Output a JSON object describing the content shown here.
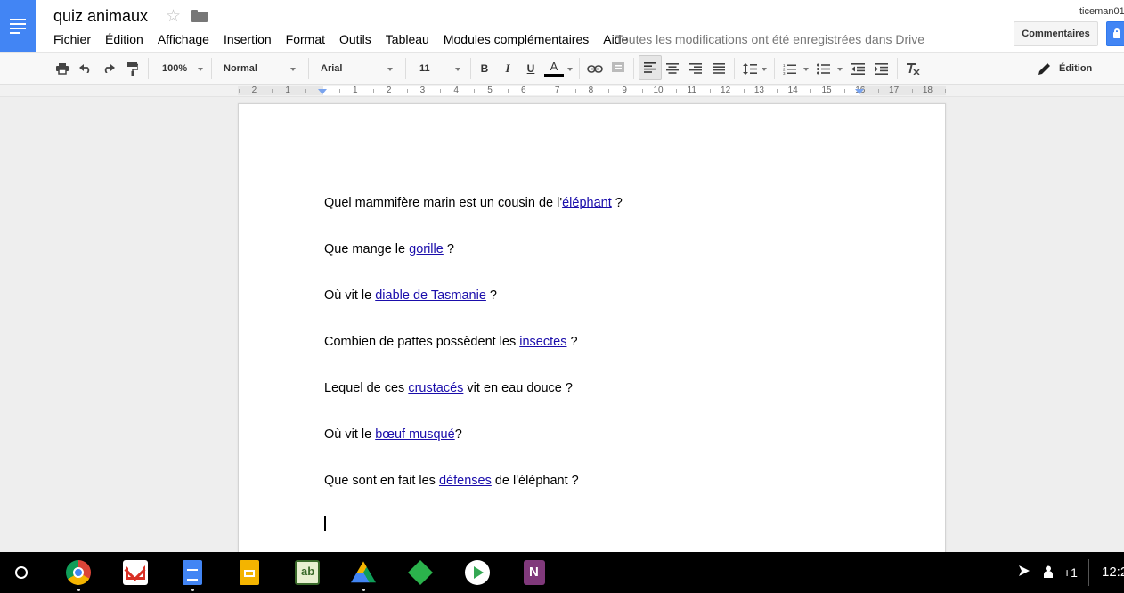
{
  "header": {
    "title": "quiz animaux",
    "save_status": "Toutes les modifications ont été enregistrées dans Drive",
    "user": "ticeman01",
    "comments_label": "Commentaires"
  },
  "menubar": {
    "items": [
      "Fichier",
      "Édition",
      "Affichage",
      "Insertion",
      "Format",
      "Outils",
      "Tableau",
      "Modules complémentaires",
      "Aide"
    ]
  },
  "toolbar": {
    "zoom": "100%",
    "style": "Normal",
    "font": "Arial",
    "font_size": "11",
    "bold": "B",
    "italic": "I",
    "underline": "U",
    "text_color_glyph": "A",
    "text_color": "#000000",
    "mode_label": "Édition"
  },
  "ruler": {
    "labels": [
      "2",
      "1",
      "1",
      "2",
      "3",
      "4",
      "5",
      "6",
      "7",
      "8",
      "9",
      "10",
      "11",
      "12",
      "13",
      "14",
      "15",
      "16",
      "17",
      "18"
    ]
  },
  "document": {
    "paragraphs": [
      {
        "before": "Quel mammifère marin est un cousin de l'",
        "link": "éléphant",
        "after": " ?"
      },
      {
        "before": "Que mange le ",
        "link": "gorille",
        "after": " ?"
      },
      {
        "before": "Où vit le ",
        "link": "diable de Tasmanie",
        "after": " ?"
      },
      {
        "before": "Combien de pattes possèdent les ",
        "link": "insectes",
        "after": " ?"
      },
      {
        "before": "Lequel de ces ",
        "link": "crustacés",
        "after": " vit en eau douce ?"
      },
      {
        "before": "Où vit le ",
        "link": "bœuf musqué",
        "after": "?"
      },
      {
        "before": "Que sont en fait les ",
        "link": "défenses",
        "after": " de l'éléphant ?"
      }
    ]
  },
  "shelf": {
    "apps": [
      "chrome-icon",
      "gmail-icon",
      "google-docs-icon",
      "google-slides-icon",
      "geogebra-icon",
      "google-drive-icon",
      "feedly-icon",
      "play-store-icon",
      "onenote-icon"
    ],
    "notification_count": "+1",
    "clock": "12:2"
  },
  "colors": {
    "accent": "#4285f4",
    "link": "#1a0dab"
  }
}
